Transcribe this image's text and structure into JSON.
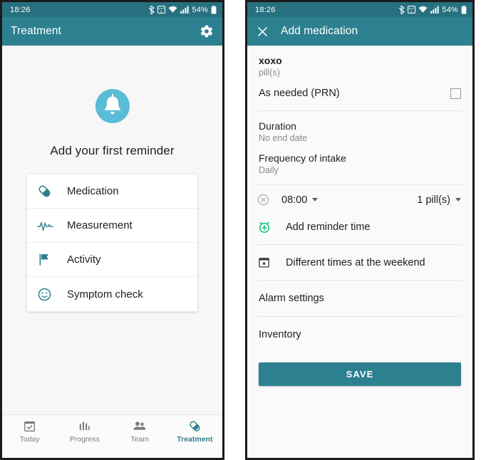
{
  "theme": {
    "teal": "#2d808f",
    "teal_dark": "#27707f",
    "bell_blue": "#5bbcd6",
    "green": "#00c070",
    "grey_text": "#8b8b8b"
  },
  "statusbar": {
    "time": "18:26",
    "battery_percent": "54%",
    "icons": [
      "bluetooth-icon",
      "volte-icon",
      "wifi-icon",
      "signal-icon",
      "battery-icon"
    ]
  },
  "left": {
    "appbar": {
      "title": "Treatment",
      "settings_icon": "gear-icon"
    },
    "empty_state": {
      "icon": "bell-reminder-icon",
      "title": "Add your first reminder"
    },
    "options": [
      {
        "label": "Medication",
        "icon": "pill-icon"
      },
      {
        "label": "Measurement",
        "icon": "heartbeat-icon"
      },
      {
        "label": "Activity",
        "icon": "flag-icon"
      },
      {
        "label": "Symptom check",
        "icon": "smiley-icon"
      }
    ],
    "bottom_nav": [
      {
        "label": "Today",
        "icon": "calendar-check-icon",
        "active": false
      },
      {
        "label": "Progress",
        "icon": "bar-chart-icon",
        "active": false
      },
      {
        "label": "Team",
        "icon": "people-icon",
        "active": false
      },
      {
        "label": "Treatment",
        "icon": "pill-icon",
        "active": true
      }
    ]
  },
  "right": {
    "appbar": {
      "title": "Add medication",
      "close_icon": "close-icon"
    },
    "medication": {
      "name": "xoxo",
      "unit": "pill(s)"
    },
    "prn": {
      "label": "As needed (PRN)",
      "checked": false
    },
    "duration": {
      "label": "Duration",
      "value": "No end date"
    },
    "frequency": {
      "label": "Frequency of intake",
      "value": "Daily"
    },
    "reminder_time": {
      "delete_icon": "remove-circle-icon",
      "time": "08:00",
      "quantity": "1 pill(s)"
    },
    "add_reminder": {
      "label": "Add reminder time",
      "icon": "alarm-add-icon"
    },
    "weekend": {
      "label": "Different times at the weekend",
      "icon": "calendar-icon"
    },
    "alarm_settings": {
      "label": "Alarm settings"
    },
    "inventory": {
      "label": "Inventory"
    },
    "save": {
      "label": "SAVE"
    }
  }
}
